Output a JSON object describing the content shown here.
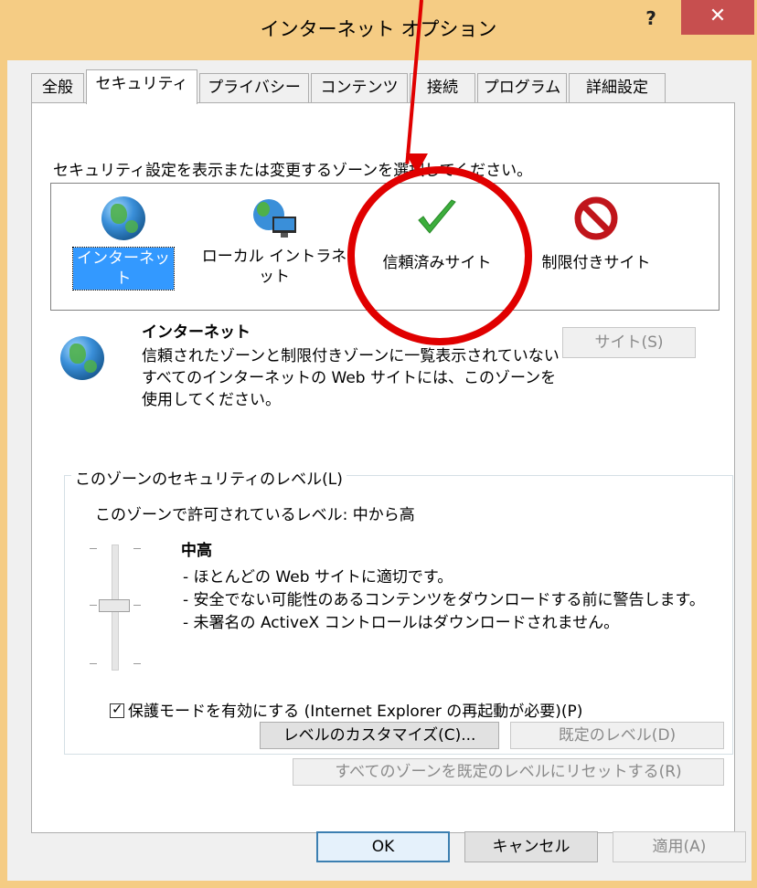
{
  "window": {
    "title": "インターネット オプション",
    "help_label": "?",
    "close_label": "✕"
  },
  "tabs": [
    {
      "label": "全般"
    },
    {
      "label": "セキュリティ"
    },
    {
      "label": "プライバシー"
    },
    {
      "label": "コンテンツ"
    },
    {
      "label": "接続"
    },
    {
      "label": "プログラム"
    },
    {
      "label": "詳細設定"
    }
  ],
  "security": {
    "instruction": "セキュリティ設定を表示または変更するゾーンを選択してください。",
    "zones": [
      {
        "label": "インターネット",
        "icon": "globe-icon",
        "selected": true
      },
      {
        "label": "ローカル イントラネット",
        "icon": "intranet-icon",
        "selected": false
      },
      {
        "label": "信頼済みサイト",
        "icon": "checkmark-icon",
        "selected": false
      },
      {
        "label": "制限付きサイト",
        "icon": "no-entry-icon",
        "selected": false
      }
    ],
    "info_title": "インターネット",
    "info_description": "信頼されたゾーンと制限付きゾーンに一覧表示されていないすべてのインターネットの Web サイトには、このゾーンを使用してください。",
    "sites_button": "サイト(S)",
    "level_group_label": "このゾーンのセキュリティのレベル(L)",
    "allowed_level": "このゾーンで許可されているレベル: 中から高",
    "level_name": "中高",
    "level_details": [
      "- ほとんどの Web サイトに適切です。",
      "- 安全でない可能性のあるコンテンツをダウンロードする前に警告します。",
      "- 未署名の ActiveX コントロールはダウンロードされません。"
    ],
    "protected_mode_label": "保護モードを有効にする (Internet Explorer の再起動が必要)(P)",
    "protected_mode_checked": true,
    "custom_level_button": "レベルのカスタマイズ(C)...",
    "default_level_button": "既定のレベル(D)",
    "reset_all_button": "すべてのゾーンを既定のレベルにリセットする(R)"
  },
  "footer": {
    "ok": "OK",
    "cancel": "キャンセル",
    "apply": "適用(A)"
  },
  "colors": {
    "title_bar": "#f5cc84",
    "close_button": "#c74f4f",
    "selection": "#3399ff",
    "annotation": "#e00000"
  }
}
